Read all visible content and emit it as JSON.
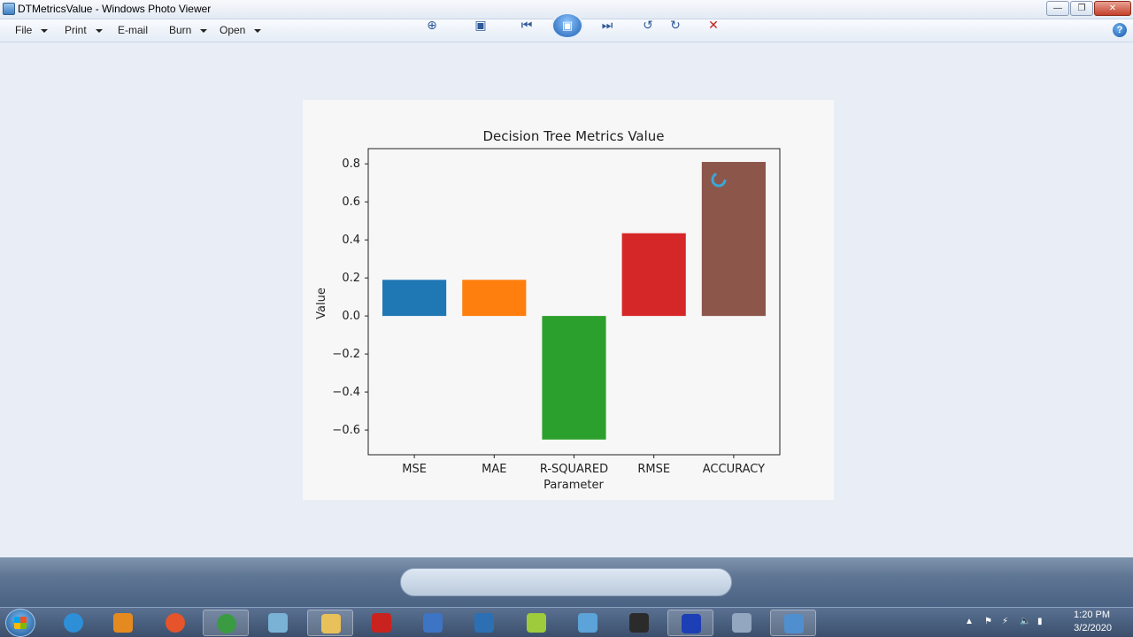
{
  "window": {
    "title": "DTMetricsValue - Windows Photo Viewer"
  },
  "menu": {
    "items": [
      "File",
      "Print",
      "E-mail",
      "Burn",
      "Open"
    ]
  },
  "chart_data": {
    "type": "bar",
    "title": "Decision Tree Metrics Value",
    "xlabel": "Parameter",
    "ylabel": "Value",
    "categories": [
      "MSE",
      "MAE",
      "R-SQUARED",
      "RMSE",
      "ACCURACY"
    ],
    "values": [
      0.19,
      0.19,
      -0.65,
      0.435,
      0.81
    ],
    "colors": [
      "#1f77b4",
      "#ff7f0e",
      "#2ca02c",
      "#d62728",
      "#8c564b"
    ],
    "yticks": [
      "0.8",
      "0.6",
      "0.4",
      "0.2",
      "0.0",
      "−0.2",
      "−0.4",
      "−0.6"
    ],
    "ytick_values": [
      0.8,
      0.6,
      0.4,
      0.2,
      0.0,
      -0.2,
      -0.4,
      -0.6
    ],
    "ylim": [
      -0.73,
      0.88
    ],
    "grid": false
  },
  "taskbar": {
    "time": "1:20 PM",
    "date": "3/2/2020",
    "apps": [
      {
        "name": "ie-icon",
        "color": "#2d8fd8"
      },
      {
        "name": "media-player-icon",
        "color": "#e58a1f"
      },
      {
        "name": "firefox-icon",
        "color": "#e5542a"
      },
      {
        "name": "chrome-icon",
        "color": "#3a9b43"
      },
      {
        "name": "notes-icon",
        "color": "#7ab2d6"
      },
      {
        "name": "explorer-folder-icon",
        "color": "#e8c15a"
      },
      {
        "name": "pdf-icon",
        "color": "#c8231e"
      },
      {
        "name": "word-doc-icon",
        "color": "#3d74c4"
      },
      {
        "name": "text-editor-icon",
        "color": "#2c6fb3"
      },
      {
        "name": "hs-app-icon",
        "color": "#9ecb3c"
      },
      {
        "name": "paint-icon",
        "color": "#5ba3d9"
      },
      {
        "name": "terminal-icon",
        "color": "#2b2b2b"
      },
      {
        "name": "capture-icon",
        "color": "#1d3fb5"
      },
      {
        "name": "feather-icon",
        "color": "#93a7c0"
      },
      {
        "name": "photo-viewer-icon",
        "color": "#4f8fcf"
      }
    ]
  }
}
